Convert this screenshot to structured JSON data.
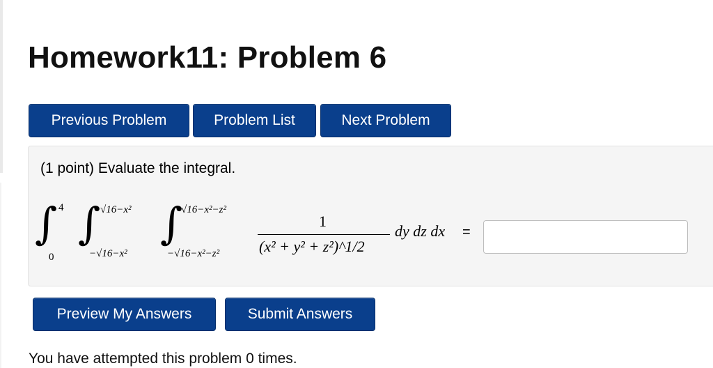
{
  "page": {
    "title": "Homework11: Problem 6"
  },
  "nav": {
    "previous_label": "Previous Problem",
    "list_label": "Problem List",
    "next_label": "Next Problem"
  },
  "problem": {
    "points": "(1 point)",
    "prompt": "Evaluate the integral.",
    "outer_lower": "0",
    "outer_upper": "4",
    "middle_lower": "−√16−x²",
    "middle_upper": "√16−x²",
    "inner_lower": "−√16−x²−z²",
    "inner_upper": "√16−x²−z²",
    "numerator": "1",
    "denominator": "(x² + y² + z²)^1/2",
    "differentials": "dy dz dx",
    "equals": "=",
    "answer_value": ""
  },
  "actions": {
    "preview_label": "Preview My Answers",
    "submit_label": "Submit Answers"
  },
  "status": {
    "attempts_text": "You have attempted this problem 0 times."
  },
  "colors": {
    "button_bg": "#0a3f8c",
    "panel_bg": "#f5f5f5"
  }
}
